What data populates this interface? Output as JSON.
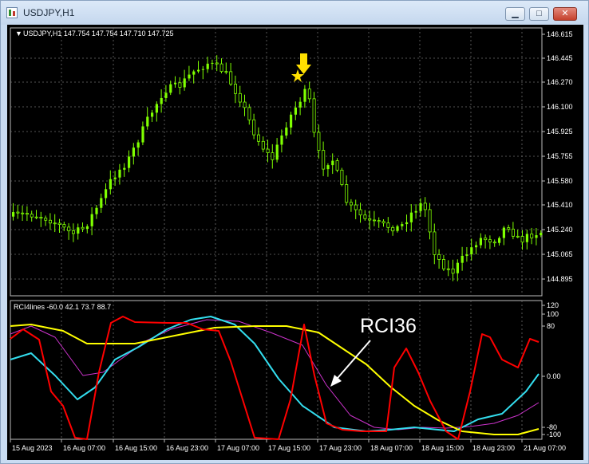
{
  "window": {
    "title": "USDJPY,H1",
    "minimize_symbol": "▁",
    "maximize_symbol": "□",
    "close_symbol": "✕"
  },
  "main_chart": {
    "header": "USDJPY,H1  147.754 147.754 147.710 147.725",
    "price_labels": [
      "146.615",
      "146.445",
      "146.270",
      "146.100",
      "145.925",
      "145.755",
      "145.580",
      "145.410",
      "145.240",
      "145.065",
      "144.895"
    ],
    "colors": {
      "background": "#000000",
      "candle": "#7fff00",
      "grid": "#6e6e6e",
      "axis_text": "#ffffff"
    }
  },
  "indicator": {
    "header": "RCI4lines -60.0 42.1 73.7 88.7",
    "axis_labels": [
      "120",
      "100",
      "80",
      "0.00",
      "-80",
      "-100"
    ],
    "annotation_text": "RCI36",
    "colors": {
      "red": "#ff0000",
      "yellow": "#ffff00",
      "cyan": "#33ddee",
      "magenta": "#cc33cc"
    }
  },
  "time_axis": {
    "labels": [
      "15 Aug 2023",
      "16 Aug 07:00",
      "16 Aug 15:00",
      "16 Aug 23:00",
      "17 Aug 07:00",
      "17 Aug 15:00",
      "17 Aug 23:00",
      "18 Aug 07:00",
      "18 Aug 15:00",
      "18 Aug 23:00",
      "21 Aug 07:00"
    ]
  },
  "markers": {
    "star": {
      "color": "#ffe000",
      "icon": "star-icon"
    },
    "arrow": {
      "color": "#ffe000",
      "icon": "down-arrow-icon"
    }
  }
}
